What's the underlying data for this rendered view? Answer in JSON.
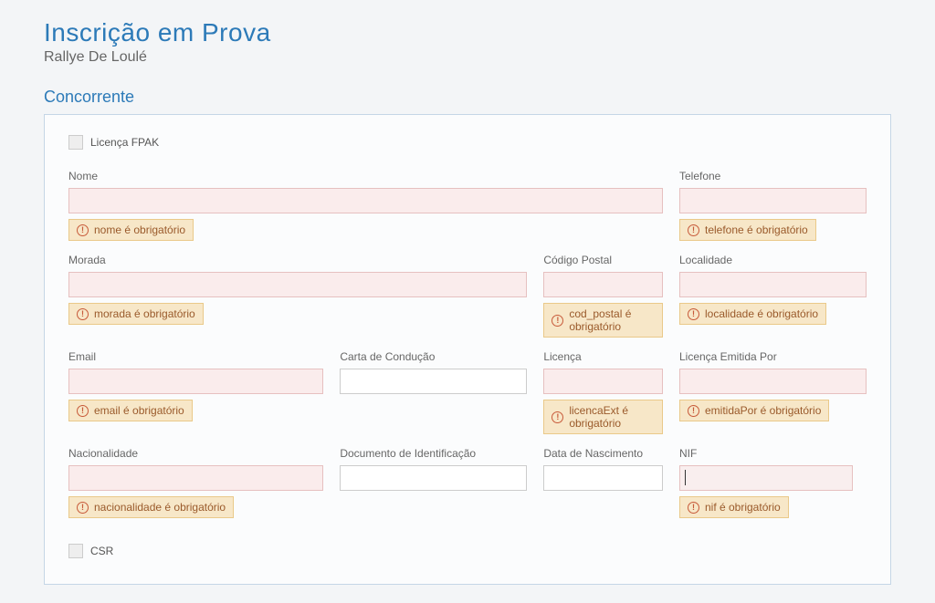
{
  "page": {
    "title": "Inscrição em Prova",
    "subtitle": "Rallye De Loulé",
    "section": "Concorrente"
  },
  "checkboxes": {
    "licenca_fpak": "Licença FPAK",
    "csr": "CSR"
  },
  "fields": {
    "nome": {
      "label": "Nome",
      "error": "nome é obrigatório"
    },
    "telefone": {
      "label": "Telefone",
      "error": "telefone é obrigatório"
    },
    "morada": {
      "label": "Morada",
      "error": "morada é obrigatório"
    },
    "codigo_postal": {
      "label": "Código Postal",
      "error": "cod_postal é obrigatório"
    },
    "localidade": {
      "label": "Localidade",
      "error": "localidade é obrigatório"
    },
    "email": {
      "label": "Email",
      "error": "email é obrigatório"
    },
    "carta_conducao": {
      "label": "Carta de Condução"
    },
    "licenca": {
      "label": "Licença",
      "error": "licencaExt é obrigatório"
    },
    "licenca_emitida_por": {
      "label": "Licença Emitida Por",
      "error": "emitidaPor é obrigatório"
    },
    "nacionalidade": {
      "label": "Nacionalidade",
      "error": "nacionalidade é obrigatório"
    },
    "documento_identificacao": {
      "label": "Documento de Identificação"
    },
    "data_nascimento": {
      "label": "Data de Nascimento"
    },
    "nif": {
      "label": "NIF",
      "error": "nif é obrigatório"
    }
  }
}
